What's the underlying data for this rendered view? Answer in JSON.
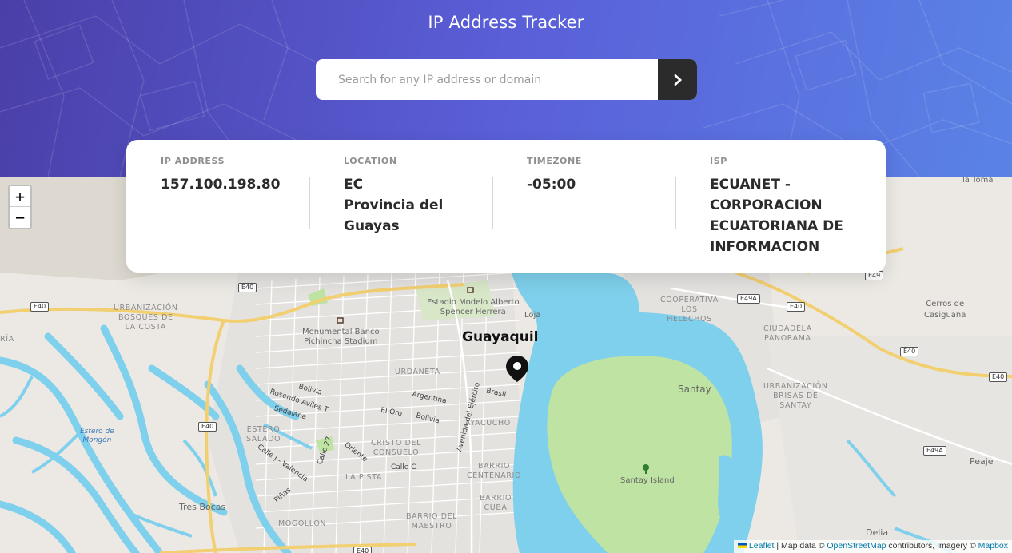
{
  "header": {
    "title": "IP Address Tracker",
    "search_placeholder": "Search for any IP address or domain",
    "search_value": "",
    "submit_icon": "chevron-right-icon"
  },
  "info": {
    "ip_label": "IP ADDRESS",
    "ip_value": "157.100.198.80",
    "location_label": "LOCATION",
    "location_value": "EC\nProvincia del Guayas",
    "timezone_label": "TIMEZONE",
    "timezone_value": "-05:00",
    "isp_label": "ISP",
    "isp_value": "ECUANET - CORPORACION ECUATORIANA DE INFORMACION"
  },
  "map": {
    "zoom_in": "+",
    "zoom_out": "−",
    "labels": {
      "guayaquil": "Guayaquil",
      "santay": "Santay",
      "santay_island": "Santay Island",
      "la_toma": "la Toma",
      "cerros": "Cerros de\nCasiguana",
      "peaje": "Peaje",
      "delia": "Delia",
      "tres_bocas": "Tres Bocas",
      "estadio": "Estadio Modelo Alberto\nSpencer Herrera",
      "monumental": "Monumental Banco\nPichincha Stadium",
      "loja": "Loja",
      "urbanizacion_bosques": "URBANIZACIÓN\nBOSQUES DE\nLA COSTA",
      "cooperativa": "COOPERATIVA\nLOS\nHELECHOS",
      "ciudadela": "CIUDADELA\nPANORAMA",
      "brisas": "URBANIZACIÓN\nBRISAS DE\nSANTAY",
      "urdaneta": "URDANETA",
      "ayacucho": "AYACUCHO",
      "cristo": "CRISTO DEL\nCONSUELO",
      "barrio_centenario": "BARRIO\nCENTENARIO",
      "barrio_cuba": "BARRIO\nCUBA",
      "barrio_maestro": "BARRIO DEL\nMAESTRO",
      "la_pista": "LA PISTA",
      "mogollon": "MOGOLLÓN",
      "estero_salado": "ESTERO\nSALADO",
      "estero_mongon": "Estero de\nMongón",
      "ria": "RÍA",
      "bolivia": "Bolivia",
      "argentina": "Argentina",
      "brasil": "Brasil",
      "el_oro": "El Oro",
      "bolivia2": "Bolivia",
      "rosendo": "Rosendo Aviles T",
      "sedalana": "Sedalana",
      "calle_c": "Calle C",
      "oriente": "Oriente",
      "calle27": "Calle 27",
      "pinas": "Piñas",
      "valencia": "Calle J - Valencia",
      "avenida": "Avenida del Ejército"
    },
    "shields": {
      "e40a": "E40",
      "e40b": "E40",
      "e40c": "E40",
      "e40d": "E40",
      "e40e": "E40",
      "e40f": "E40",
      "e40g": "E40",
      "e49": "E49",
      "e49a": "E49A",
      "e49a2": "E49A"
    },
    "attribution": {
      "leaflet": "Leaflet",
      "mapdata": " | Map data © ",
      "osm": "OpenStreetMap",
      "contrib": " contributors, Imagery © ",
      "mapbox": "Mapbox"
    }
  },
  "colors": {
    "header_start": "#4a3fa8",
    "header_end": "#5a83e6",
    "water": "#7fd0ec",
    "park": "#bfe3a3",
    "land": "#ece9e4",
    "button": "#2b2b2b"
  }
}
